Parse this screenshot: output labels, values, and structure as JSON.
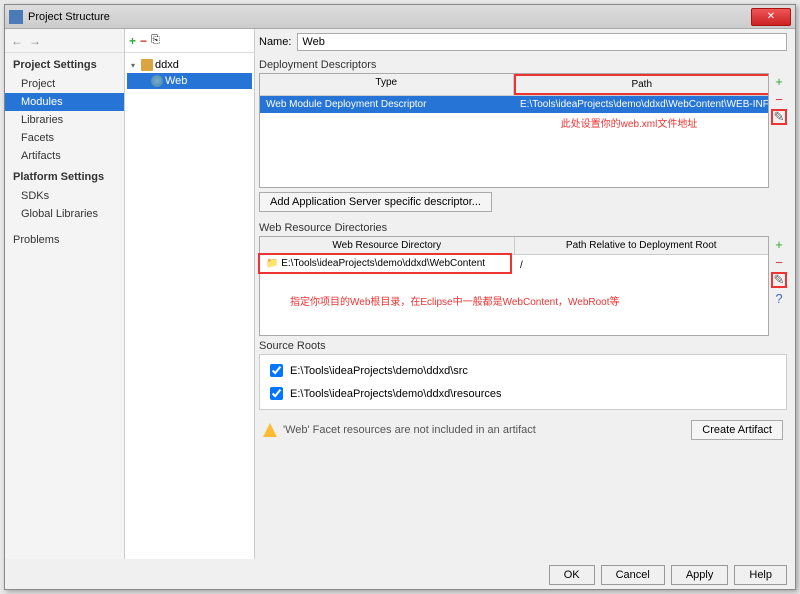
{
  "window": {
    "title": "Project Structure"
  },
  "sidebar": {
    "sections": [
      {
        "label": "Project Settings",
        "items": [
          "Project",
          "Modules",
          "Libraries",
          "Facets",
          "Artifacts"
        ]
      },
      {
        "label": "Platform Settings",
        "items": [
          "SDKs",
          "Global Libraries"
        ]
      },
      {
        "label": "",
        "items": [
          "Problems"
        ]
      }
    ],
    "selected": "Modules"
  },
  "tree": {
    "root": {
      "label": "ddxd",
      "expanded": true
    },
    "child": {
      "label": "Web",
      "selected": true
    }
  },
  "name_label": "Name:",
  "name_value": "Web",
  "deployment": {
    "heading": "Deployment Descriptors",
    "col_type": "Type",
    "col_path": "Path",
    "row_type": "Web Module Deployment Descriptor",
    "row_path": "E:\\Tools\\ideaProjects\\demo\\ddxd\\WebContent\\WEB-INF\\web...",
    "annotation": "此处设置你的web.xml文件地址",
    "add_button": "Add Application Server specific descriptor..."
  },
  "resource_dirs": {
    "heading": "Web Resource Directories",
    "col_dir": "Web Resource Directory",
    "col_rel": "Path Relative to Deployment Root",
    "row_dir": "E:\\Tools\\ideaProjects\\demo\\ddxd\\WebContent",
    "row_rel": "/",
    "annotation": "指定你项目的Web根目录，在Eclipse中一般都是WebContent，WebRoot等"
  },
  "source_roots": {
    "heading": "Source Roots",
    "items": [
      "E:\\Tools\\ideaProjects\\demo\\ddxd\\src",
      "E:\\Tools\\ideaProjects\\demo\\ddxd\\resources"
    ]
  },
  "warning": {
    "text": "'Web' Facet resources are not included in an artifact",
    "button": "Create Artifact"
  },
  "footer": {
    "ok": "OK",
    "cancel": "Cancel",
    "apply": "Apply",
    "help": "Help"
  }
}
